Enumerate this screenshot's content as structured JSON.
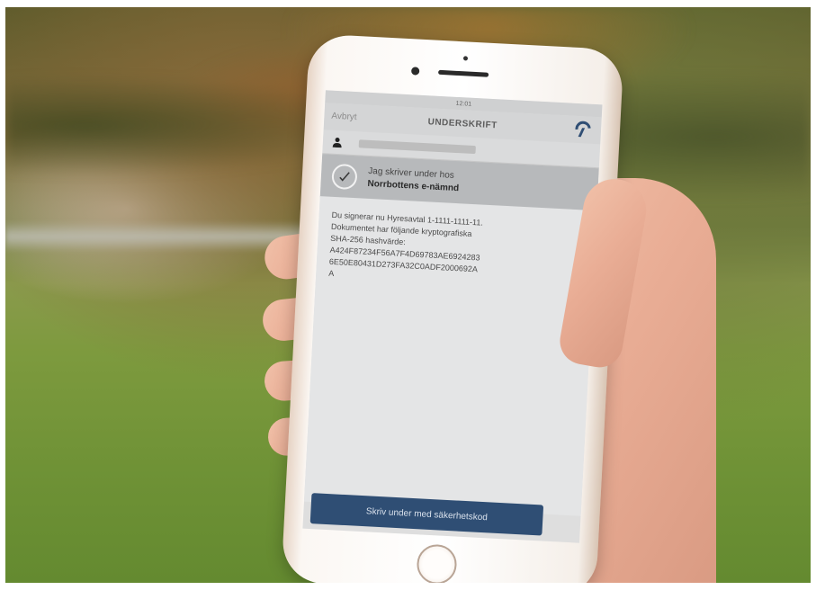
{
  "status_bar": {
    "carrier": "",
    "time": "12:01",
    "battery": ""
  },
  "nav": {
    "cancel_label": "Avbryt",
    "title": "UNDERSKRIFT"
  },
  "signer": {
    "line1": "Jag skriver under hos",
    "line2": "Norrbottens e-nämnd"
  },
  "document": {
    "text": "Du signerar nu Hyresavtal 1-1111-1111-11.\nDokumentet har följande kryptografiska\nSHA-256 hashvärde:\nA424F87234F56A7F4D69783AE6924283\n6E50E80431D273FA32C0ADF2000692A\nA"
  },
  "sign_button": {
    "label": "Skriv under med säkerhetskod"
  },
  "icons": {
    "user": "user-icon",
    "check": "checkmark-circle-icon",
    "logo": "freja-logo-icon",
    "home": "home-button"
  },
  "colors": {
    "accent_button": "#2f4e74",
    "signer_band": "#b7b9bb"
  }
}
